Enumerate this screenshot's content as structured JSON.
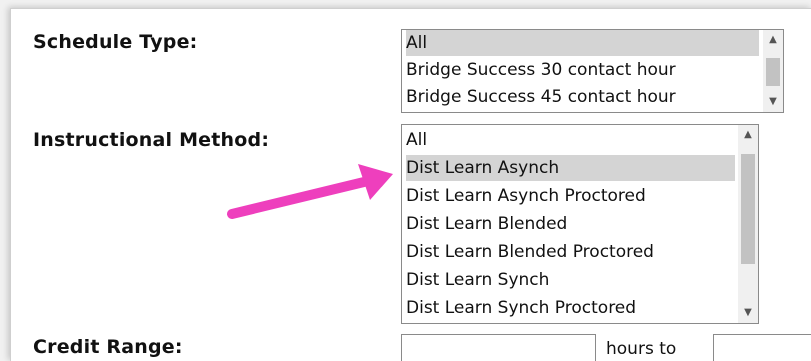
{
  "form": {
    "schedule_type": {
      "label": "Schedule Type:",
      "options": [
        {
          "text": "All",
          "selected": true
        },
        {
          "text": "Bridge Success 30 contact hour",
          "selected": false
        },
        {
          "text": "Bridge Success 45 contact hour",
          "selected": false
        }
      ]
    },
    "instructional_method": {
      "label": "Instructional Method:",
      "options": [
        {
          "text": "All",
          "selected": false
        },
        {
          "text": "Dist Learn Asynch",
          "selected": true
        },
        {
          "text": "Dist Learn Asynch Proctored",
          "selected": false
        },
        {
          "text": "Dist Learn Blended",
          "selected": false
        },
        {
          "text": "Dist Learn Blended Proctored",
          "selected": false
        },
        {
          "text": "Dist Learn Synch",
          "selected": false
        },
        {
          "text": "Dist Learn Synch Proctored",
          "selected": false
        }
      ]
    },
    "credit_range": {
      "label": "Credit Range:",
      "between_text": "hours to"
    }
  },
  "annotation": {
    "arrow_color": "#ee3fbd",
    "arrow_icon": "pointer-arrow-icon"
  },
  "colors": {
    "selected_bg": "#d4d4d4",
    "scrollbar_thumb": "#c2c2c2",
    "border": "#8a8a8a"
  }
}
